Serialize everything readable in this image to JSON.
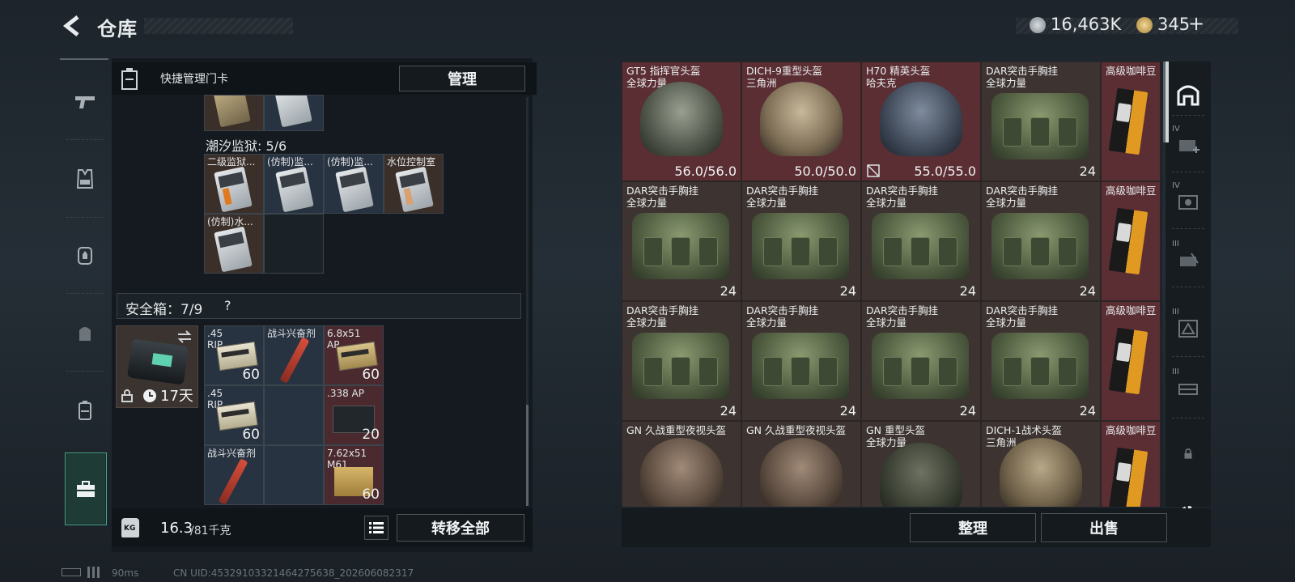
{
  "header": {
    "title": "仓库",
    "currency1_value": "16,463K",
    "currency2_value": "345",
    "add_label": "+"
  },
  "left_nav": [
    "pistol-icon",
    "armor-vest-icon",
    "backpack-icon",
    "bag-icon",
    "canister-icon",
    "toolbox-icon"
  ],
  "left_panel": {
    "quick_card_label": "快捷管理门卡",
    "manage_button": "管理",
    "prison_section": "潮汐监狱: 5/6",
    "prison_cards": [
      "二级监狱...",
      "(仿制)监...",
      "(仿制)监...",
      "水位控制室",
      "(仿制)水..."
    ],
    "safebox_label": "安全箱：7/9",
    "safebox_help": "?",
    "safebox_days": "17天",
    "safebox_items": [
      {
        "name": ".45 RIP",
        "qty": "60"
      },
      {
        "name": "战斗兴奋剂",
        "qty": ""
      },
      {
        "name": "6.8x51 AP",
        "qty": "60"
      },
      {
        "name": ".45 RIP",
        "qty": "60"
      },
      {
        "name": ".338 AP",
        "qty": "20"
      },
      {
        "name": "战斗兴奋剂",
        "qty": ""
      },
      {
        "name": "7.62x51 M61",
        "qty": "60"
      }
    ],
    "weight_value": "16.3",
    "weight_max": "/81千克",
    "transfer_all_button": "转移全部",
    "weight_icon_label": "KG"
  },
  "grid": {
    "row1": [
      {
        "name": "GT5 指挥官头盔",
        "sub": "全球力量",
        "qty": "56.0/56.0"
      },
      {
        "name": "DICH-9重型头盔",
        "sub": "三角洲",
        "qty": "50.0/50.0"
      },
      {
        "name": "H70 精英头盔",
        "sub": "哈夫克",
        "qty": "55.0/55.0"
      },
      {
        "name": "DAR突击手胸挂",
        "sub": "全球力量",
        "qty": "24"
      },
      {
        "name": "高级咖啡豆",
        "sub": "",
        "qty": ""
      }
    ],
    "row2": [
      {
        "name": "DAR突击手胸挂",
        "sub": "全球力量",
        "qty": "24"
      },
      {
        "name": "DAR突击手胸挂",
        "sub": "全球力量",
        "qty": "24"
      },
      {
        "name": "DAR突击手胸挂",
        "sub": "全球力量",
        "qty": "24"
      },
      {
        "name": "DAR突击手胸挂",
        "sub": "全球力量",
        "qty": "24"
      },
      {
        "name": "高级咖啡豆",
        "sub": "",
        "qty": ""
      }
    ],
    "row3": [
      {
        "name": "DAR突击手胸挂",
        "sub": "全球力量",
        "qty": "24"
      },
      {
        "name": "DAR突击手胸挂",
        "sub": "全球力量",
        "qty": "24"
      },
      {
        "name": "DAR突击手胸挂",
        "sub": "全球力量",
        "qty": "24"
      },
      {
        "name": "DAR突击手胸挂",
        "sub": "全球力量",
        "qty": "24"
      },
      {
        "name": "高级咖啡豆",
        "sub": "",
        "qty": ""
      }
    ],
    "row4": [
      {
        "name": "GN 久战重型夜视头盔",
        "sub": "",
        "qty": ""
      },
      {
        "name": "GN 久战重型夜视头盔",
        "sub": "",
        "qty": ""
      },
      {
        "name": "GN 重型头盔",
        "sub": "全球力量",
        "qty": ""
      },
      {
        "name": "DICH-1战术头盔",
        "sub": "三角洲",
        "qty": ""
      },
      {
        "name": "高级咖啡豆",
        "sub": "",
        "qty": ""
      }
    ]
  },
  "right_tabs": {
    "tab2_tier": "IV",
    "tab3_tier": "IV",
    "tab4_tier": "III",
    "tab5_tier": "III",
    "tab6_tier": "III"
  },
  "bottom": {
    "sort_button": "整理",
    "sell_button": "出售",
    "ping": "90ms",
    "uid": "CN UID:4532910332146427563​8_202606082317"
  },
  "colors": {
    "accent": "#46a58c",
    "cell_red": "#5a2e33",
    "cell_brown": "#3d3431"
  }
}
